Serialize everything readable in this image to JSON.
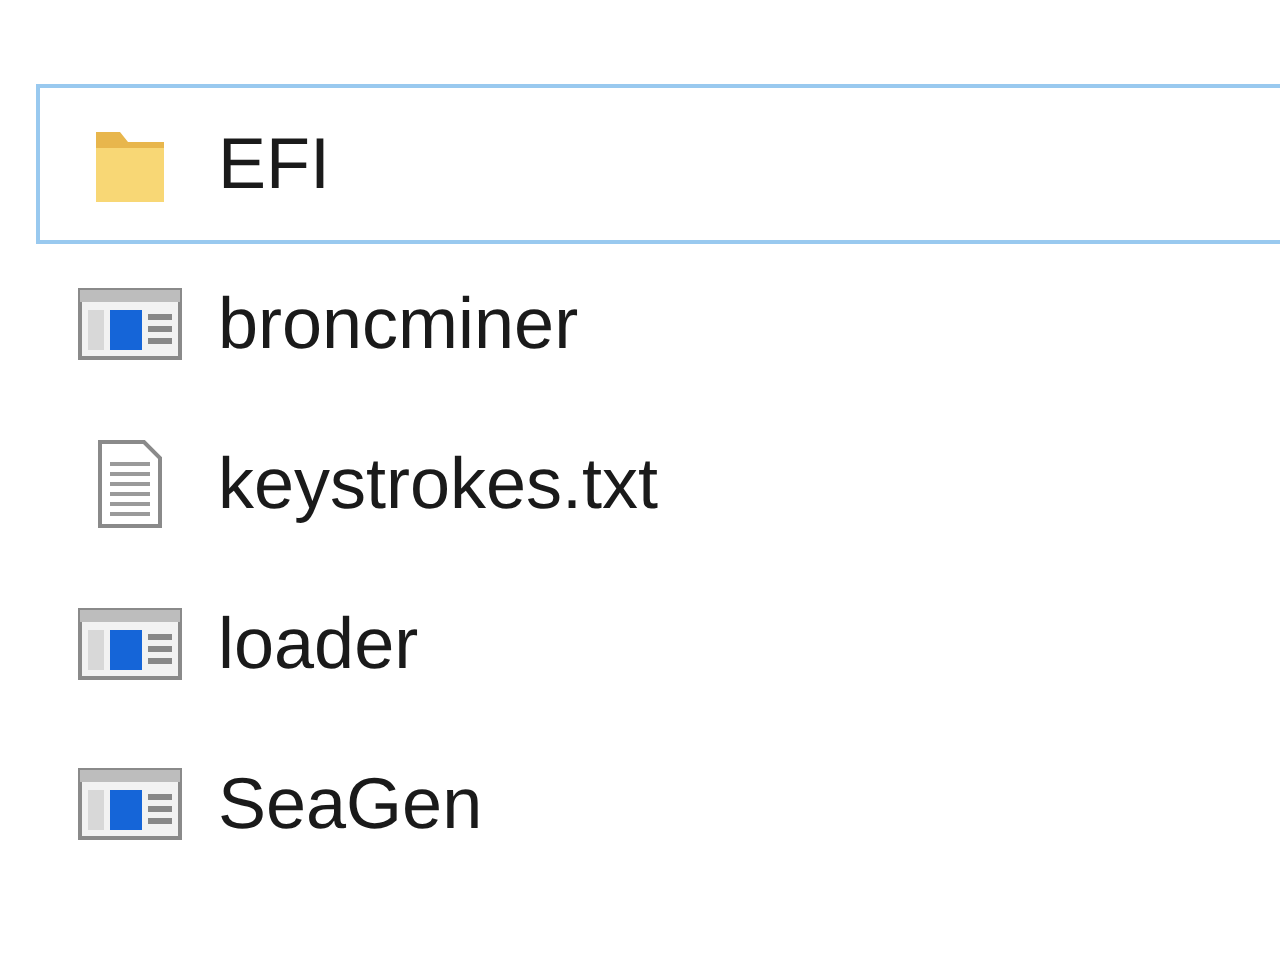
{
  "files": [
    {
      "name": "EFI",
      "kind": "folder",
      "focused": true
    },
    {
      "name": "broncminer",
      "kind": "app",
      "focused": false
    },
    {
      "name": "keystrokes.txt",
      "kind": "text",
      "focused": false
    },
    {
      "name": "loader",
      "kind": "app",
      "focused": false
    },
    {
      "name": "SeaGen",
      "kind": "app",
      "focused": false
    }
  ]
}
